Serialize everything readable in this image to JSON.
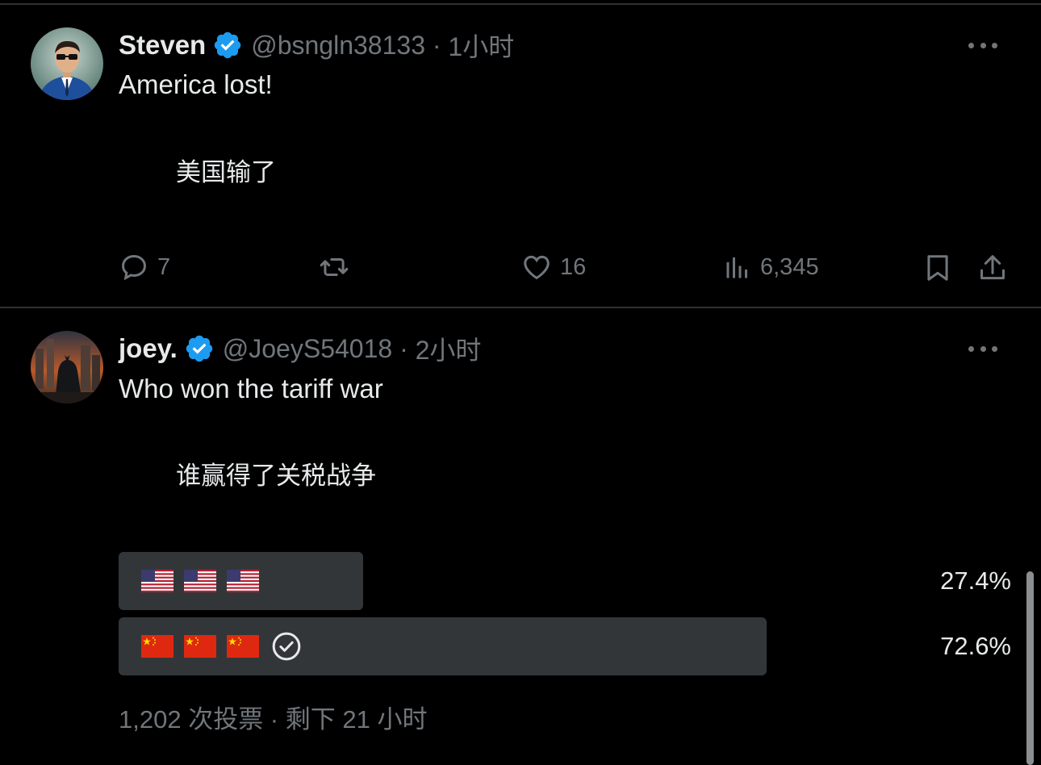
{
  "tweet1": {
    "name": "Steven",
    "handle": "@bsngln38133",
    "time": "1小时",
    "text_en": "America lost!",
    "text_zh": "美国输了",
    "actions": {
      "replies": "7",
      "likes": "16",
      "views": "6,345"
    }
  },
  "tweet2": {
    "name": "joey.",
    "handle": "@JoeyS54018",
    "time": "2小时",
    "text_en": "Who won the tariff war",
    "text_zh": "谁赢得了关税战争",
    "poll": {
      "options": [
        {
          "label_icons": [
            "us-flag-icon",
            "us-flag-icon",
            "us-flag-icon"
          ],
          "percent": "27.4%",
          "fraction": 0.274
        },
        {
          "label_icons": [
            "china-flag-icon",
            "china-flag-icon",
            "china-flag-icon"
          ],
          "percent": "72.6%",
          "fraction": 0.726,
          "selected": true
        }
      ],
      "footer": "1,202 次投票 · 剩下 21 小时"
    }
  },
  "colors": {
    "background": "#000000",
    "text": "#e7e9ea",
    "muted": "#71767b",
    "verified": "#1d9bf0",
    "poll_fill": "#333639"
  }
}
